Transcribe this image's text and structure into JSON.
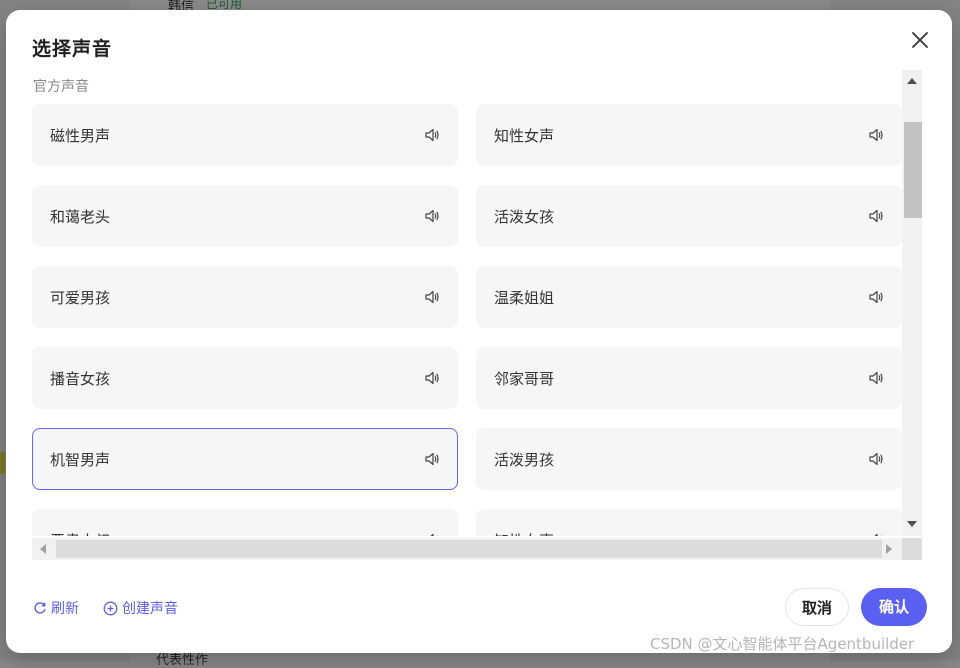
{
  "background": {
    "top_text": "韩信",
    "top_status": "已可用",
    "bottom_text": "代表性作"
  },
  "modal": {
    "title": "选择声音",
    "section_label": "官方声音",
    "voices": [
      {
        "label": "磁性男声",
        "selected": false
      },
      {
        "label": "知性女声",
        "selected": false
      },
      {
        "label": "和蔼老头",
        "selected": false
      },
      {
        "label": "活泼女孩",
        "selected": false
      },
      {
        "label": "可爱男孩",
        "selected": false
      },
      {
        "label": "温柔姐姐",
        "selected": false
      },
      {
        "label": "播音女孩",
        "selected": false
      },
      {
        "label": "邻家哥哥",
        "selected": false
      },
      {
        "label": "机智男声",
        "selected": true
      },
      {
        "label": "活泼男孩",
        "selected": false
      },
      {
        "label": "严肃大叔",
        "selected": false
      },
      {
        "label": "知性女声",
        "selected": false
      }
    ],
    "footer": {
      "refresh_label": "刷新",
      "create_label": "创建声音",
      "cancel_label": "取消",
      "confirm_label": "确认"
    }
  },
  "watermark": "CSDN @文心智能体平台Agentbuilder",
  "colors": {
    "accent": "#5b5ff2",
    "card_bg": "#f5f6f8",
    "selected_border": "#6366f1"
  },
  "icons": {
    "close": "close-icon",
    "speaker": "speaker-icon",
    "refresh": "refresh-icon",
    "create": "plus-circle-icon"
  }
}
